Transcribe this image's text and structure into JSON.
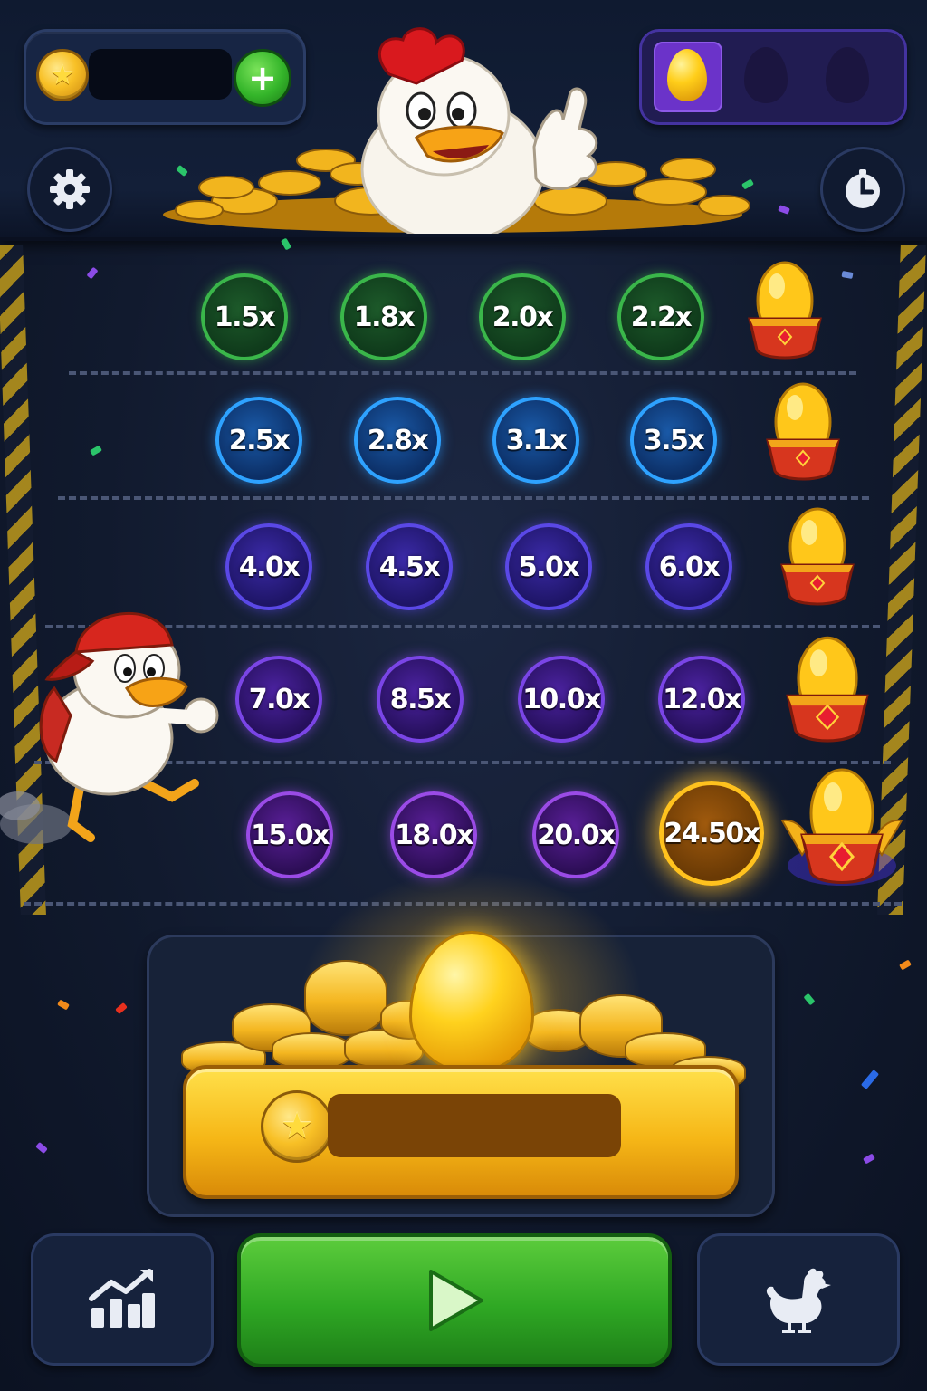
{
  "header": {
    "balance_value": "",
    "plus_label": "+",
    "coin_symbol": "★"
  },
  "egg_slots": [
    {
      "state": "collected"
    },
    {
      "state": "empty"
    },
    {
      "state": "empty"
    }
  ],
  "multipliers": [
    [
      "1.5x",
      "1.8x",
      "2.0x",
      "2.2x"
    ],
    [
      "2.5x",
      "2.8x",
      "3.1x",
      "3.5x"
    ],
    [
      "4.0x",
      "4.5x",
      "5.0x",
      "6.0x"
    ],
    [
      "7.0x",
      "8.5x",
      "10.0x",
      "12.0x"
    ],
    [
      "15.0x",
      "18.0x",
      "20.0x",
      "24.50x"
    ]
  ],
  "highlighted_multiplier": "24.50x",
  "bet": {
    "value": "",
    "coin_symbol": "★"
  },
  "icons": {
    "settings": "gear-icon",
    "history": "clock-icon",
    "stats": "chart-icon",
    "play": "play-icon",
    "chicken": "chicken-icon"
  },
  "colors": {
    "row1": "#3ab64a",
    "row2": "#2ea2ff",
    "row3": "#5a48e6",
    "row4": "#7a45e6",
    "row5": "#9a4be6",
    "gold": "#ffc21e",
    "play": "#2fa824"
  }
}
